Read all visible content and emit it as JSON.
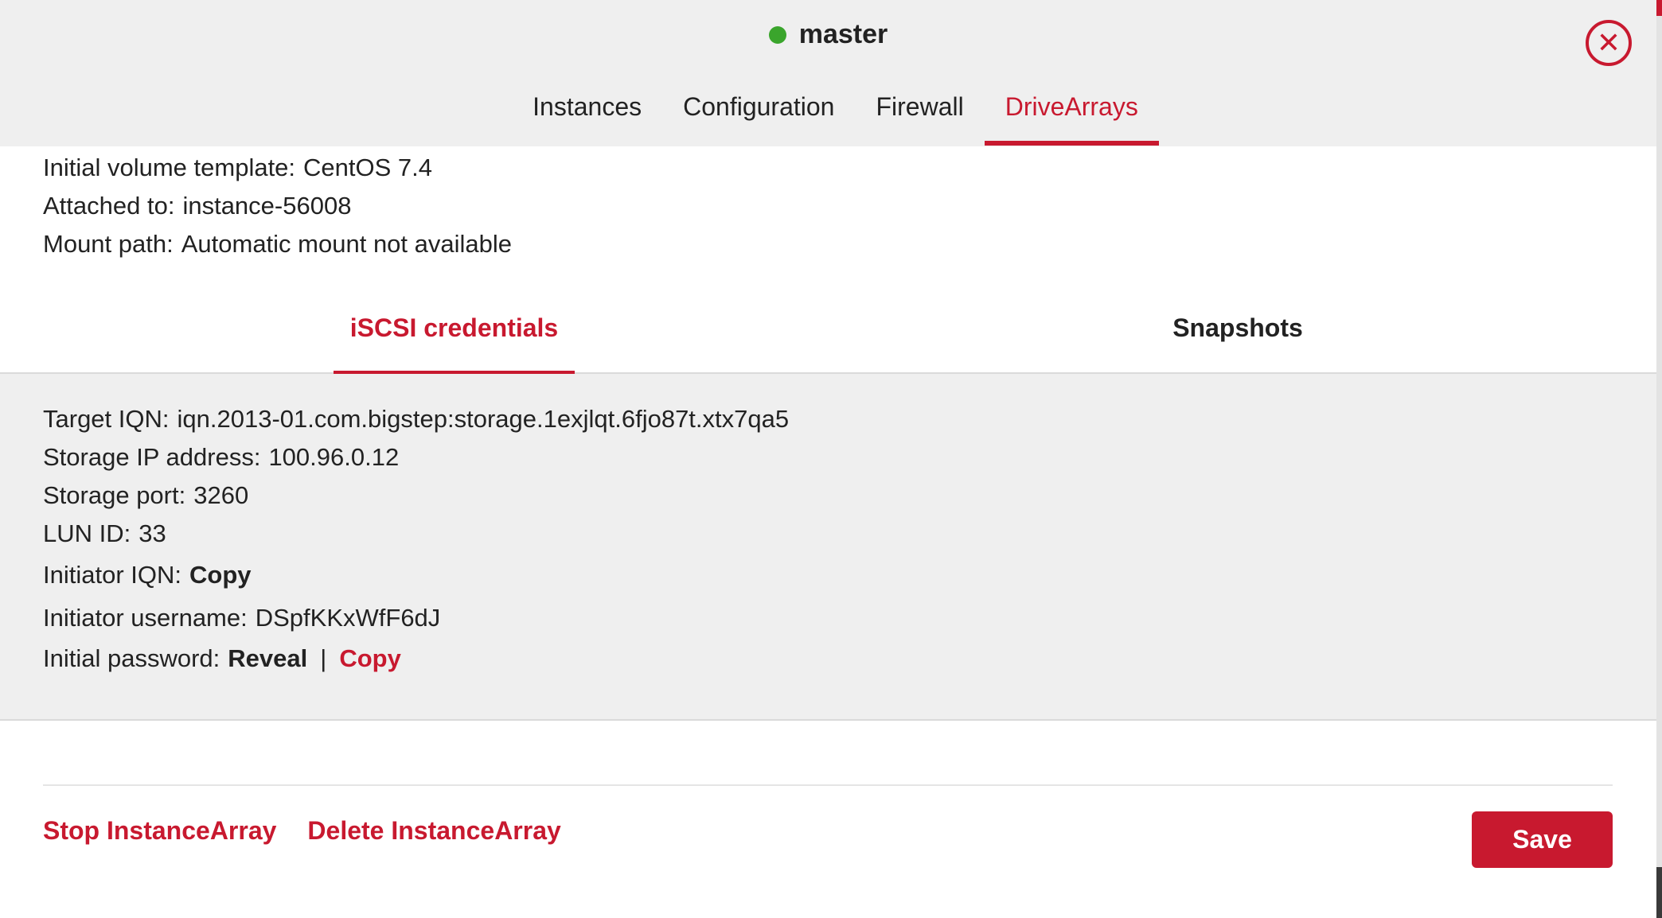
{
  "colors": {
    "accent": "#c8192f",
    "status_ok": "#3aa52c",
    "header_bg": "#efefef"
  },
  "header": {
    "title": "master",
    "status": "running",
    "close_icon": "close-circle-icon",
    "tabs": [
      {
        "label": "Instances",
        "active": false
      },
      {
        "label": "Configuration",
        "active": false
      },
      {
        "label": "Firewall",
        "active": false
      },
      {
        "label": "DriveArrays",
        "active": true
      }
    ]
  },
  "drive_info": {
    "template_label": "Initial volume template:",
    "template_value": "CentOS 7.4",
    "attached_label": "Attached to:",
    "attached_value": "instance-56008",
    "mount_label": "Mount path:",
    "mount_value": "Automatic mount not available"
  },
  "subtabs": [
    {
      "label": "iSCSI credentials",
      "active": true
    },
    {
      "label": "Snapshots",
      "active": false
    }
  ],
  "iscsi": {
    "target_iqn_label": "Target IQN:",
    "target_iqn_value": "iqn.2013-01.com.bigstep:storage.1exjlqt.6fjo87t.xtx7qa5",
    "storage_ip_label": "Storage IP address:",
    "storage_ip_value": "100.96.0.12",
    "storage_port_label": "Storage port:",
    "storage_port_value": "3260",
    "lun_label": "LUN ID:",
    "lun_value": "33",
    "initiator_iqn_label": "Initiator IQN:",
    "initiator_iqn_copy": "Copy",
    "initiator_user_label": "Initiator username:",
    "initiator_user_value": "DSpfKKxWfF6dJ",
    "password_label": "Initial password:",
    "password_reveal": "Reveal",
    "password_separator": "|",
    "password_copy": "Copy"
  },
  "footer": {
    "stop_label": "Stop InstanceArray",
    "delete_label": "Delete InstanceArray",
    "save_label": "Save"
  }
}
